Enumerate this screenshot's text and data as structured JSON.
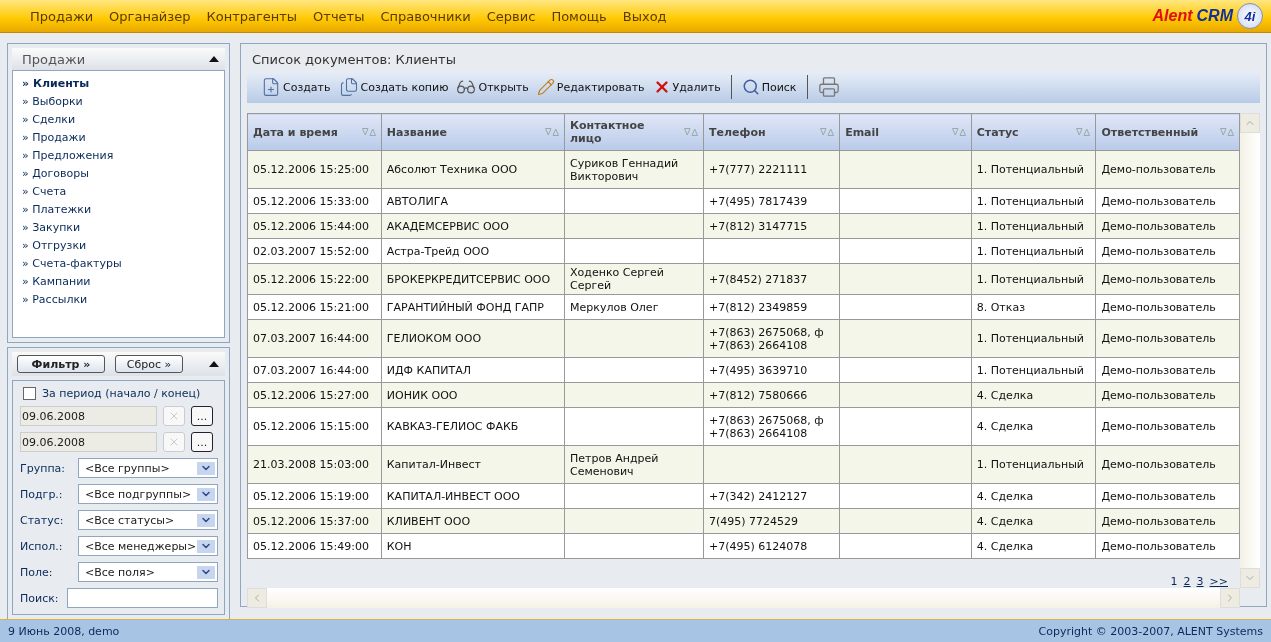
{
  "menu": [
    {
      "label": "Продажи"
    },
    {
      "label": "Органайзер"
    },
    {
      "label": "Контрагенты"
    },
    {
      "label": "Отчеты"
    },
    {
      "label": "Справочники"
    },
    {
      "label": "Сервис"
    },
    {
      "label": "Помощь"
    },
    {
      "label": "Выход"
    }
  ],
  "logo": {
    "brand": "Alent",
    "product": "CRM",
    "badge": "4i"
  },
  "sidebar": {
    "title": "Продажи",
    "items": [
      {
        "label": "» Клиенты",
        "selected": true
      },
      {
        "label": "» Выборки",
        "selected": false
      },
      {
        "label": "» Сделки",
        "selected": false
      },
      {
        "label": "» Продажи",
        "selected": false
      },
      {
        "label": "» Предложения",
        "selected": false
      },
      {
        "label": "» Договоры",
        "selected": false
      },
      {
        "label": "» Счета",
        "selected": false
      },
      {
        "label": "» Платежки",
        "selected": false
      },
      {
        "label": "» Закупки",
        "selected": false
      },
      {
        "label": "» Отгрузки",
        "selected": false
      },
      {
        "label": "» Счета-фактуры",
        "selected": false
      },
      {
        "label": "» Кампании",
        "selected": false
      },
      {
        "label": "» Рассылки",
        "selected": false
      }
    ]
  },
  "filter": {
    "apply_button": "Фильтр »",
    "reset_button": "Сброс »",
    "period": {
      "label": "За период (начало / конец)",
      "checked": false
    },
    "dates": [
      {
        "value": "09.06.2008",
        "picker": "..."
      },
      {
        "value": "09.06.2008",
        "picker": "..."
      }
    ],
    "selects": [
      {
        "label": "Группа:",
        "value": "<Все группы>"
      },
      {
        "label": "Подгр.:",
        "value": "<Все подгруппы>"
      },
      {
        "label": "Статус:",
        "value": "<Все статусы>"
      },
      {
        "label": "Испол.:",
        "value": "<Все менеджеры>"
      },
      {
        "label": "Поле:",
        "value": "<Все поля>"
      }
    ],
    "search": {
      "label": "Поиск:"
    }
  },
  "content": {
    "title": "Список документов: Клиенты",
    "toolbar": [
      {
        "label": "Создать"
      },
      {
        "label": "Создать копию"
      },
      {
        "label": "Открыть"
      },
      {
        "label": "Редактировать"
      },
      {
        "label": "Удалить"
      },
      {
        "label": "Поиск"
      }
    ],
    "table": {
      "columns": [
        "Дата и время",
        "Название",
        "Контактное лицо",
        "Телефон",
        "Email",
        "Статус",
        "Ответственный"
      ],
      "rows": [
        [
          "05.12.2006 15:25:00",
          "Абсолют Техника ООО",
          "Суриков Геннадий Викторович",
          "+7(777) 2221111",
          "",
          "1. Потенциальный",
          "Демо-пользователь"
        ],
        [
          "05.12.2006 15:33:00",
          "АВТОЛИГА",
          "",
          "+7(495) 7817439",
          "",
          "1. Потенциальный",
          "Демо-пользователь"
        ],
        [
          "05.12.2006 15:44:00",
          "АКАДЕМСЕРВИС ООО",
          "",
          "+7(812) 3147715",
          "",
          "1. Потенциальный",
          "Демо-пользователь"
        ],
        [
          "02.03.2007 15:52:00",
          "Астра-Трейд ООО",
          "",
          "",
          "",
          "1. Потенциальный",
          "Демо-пользователь"
        ],
        [
          "05.12.2006 15:22:00",
          "БРОКЕРКРЕДИТСЕРВИС ООО",
          "Ходенко Сергей Сергей",
          "+7(8452) 271837",
          "",
          "1. Потенциальный",
          "Демо-пользователь"
        ],
        [
          "05.12.2006 15:21:00",
          "ГАРАНТИЙНЫЙ ФОНД ГАПР",
          "Меркулов Олег",
          "+7(812) 2349859",
          "",
          "8. Отказ",
          "Демо-пользователь"
        ],
        [
          "07.03.2007 16:44:00",
          "ГЕЛИОКОМ ООО",
          "",
          "+7(863) 2675068, ф +7(863) 2664108",
          "",
          "1. Потенциальный",
          "Демо-пользователь"
        ],
        [
          "07.03.2007 16:44:00",
          "ИДФ КАПИТАЛ",
          "",
          "+7(495) 3639710",
          "",
          "1. Потенциальный",
          "Демо-пользователь"
        ],
        [
          "05.12.2006 15:27:00",
          "ИОНИК ООО",
          "",
          "+7(812) 7580666",
          "",
          "4. Сделка",
          "Демо-пользователь"
        ],
        [
          "05.12.2006 15:15:00",
          "КАВКАЗ-ГЕЛИОС ФАКБ",
          "",
          "+7(863) 2675068, ф +7(863) 2664108",
          "",
          "4. Сделка",
          "Демо-пользователь"
        ],
        [
          "21.03.2008 15:03:00",
          "Капитал-Инвест",
          "Петров Андрей Семенович",
          "",
          "",
          "1. Потенциальный",
          "Демо-пользователь"
        ],
        [
          "05.12.2006 15:19:00",
          "КАПИТАЛ-ИНВЕСТ ООО",
          "",
          "+7(342) 2412127",
          "",
          "4. Сделка",
          "Демо-пользователь"
        ],
        [
          "05.12.2006 15:37:00",
          "КЛИВЕНТ ООО",
          "",
          "7(495) 7724529",
          "",
          "4. Сделка",
          "Демо-пользователь"
        ],
        [
          "05.12.2006 15:49:00",
          "КОН",
          "",
          "+7(495) 6124078",
          "",
          "4. Сделка",
          "Демо-пользователь"
        ]
      ]
    },
    "pagination": [
      {
        "label": "1",
        "selected": true
      },
      {
        "label": "2",
        "selected": false
      },
      {
        "label": "3",
        "selected": false
      },
      {
        "label": ">>",
        "selected": false
      }
    ]
  },
  "status_bar": {
    "left": "9 Июнь 2008, demo",
    "right": "Copyright © 2003-2007, ALENT Systems"
  }
}
